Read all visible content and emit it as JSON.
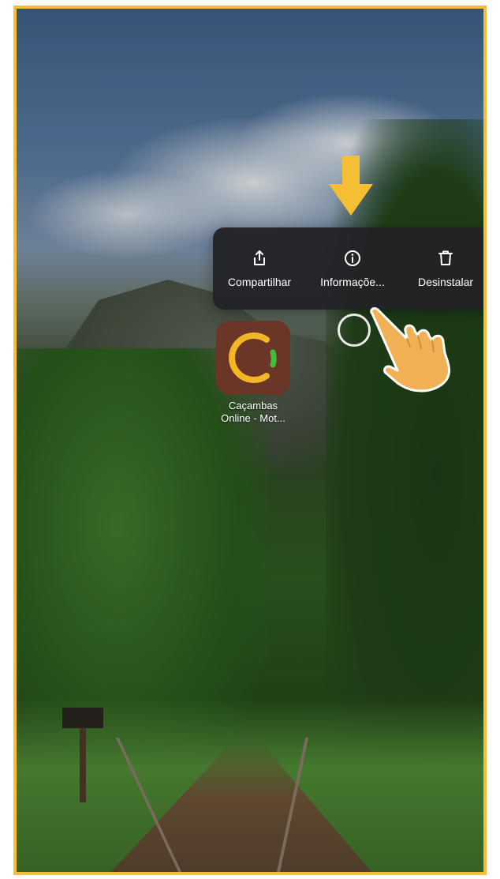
{
  "context_menu": {
    "items": [
      {
        "label": "Compartilhar",
        "icon": "share-icon"
      },
      {
        "label": "Informaçõe...",
        "icon": "info-icon"
      },
      {
        "label": "Desinstalar",
        "icon": "trash-icon"
      }
    ]
  },
  "app": {
    "label_line1": "Caçambas",
    "label_line2": "Online - Mot...",
    "icon": "app-logo-icon"
  },
  "annotations": {
    "arrow": "down-arrow-icon",
    "hand": "pointing-hand-icon"
  },
  "colors": {
    "frame_border": "#f4bf35",
    "menu_background": "#222226",
    "app_icon_background": "#6b3528",
    "logo_yellow": "#f3b726",
    "logo_green": "#3fbf3a",
    "hand": "#f2b055"
  }
}
